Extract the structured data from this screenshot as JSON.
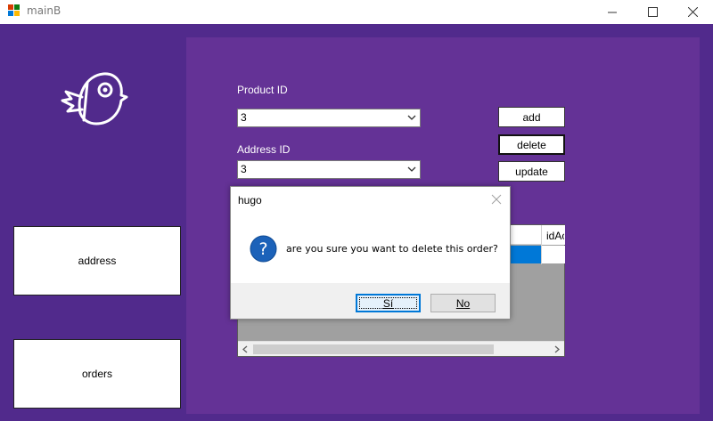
{
  "window": {
    "title": "mainB",
    "controls": [
      "minimize-icon",
      "maximize-icon",
      "close-icon"
    ]
  },
  "sidebar": {
    "logo_icon": "bird-icon",
    "address_label": "address",
    "orders_label": "orders"
  },
  "form": {
    "product_id_label": "Product ID",
    "product_id_value": "3",
    "address_id_label": "Address ID",
    "address_id_value": "3",
    "add_label": "add",
    "delete_label": "delete",
    "update_label": "update"
  },
  "grid": {
    "visible_column_header": "idAc"
  },
  "dialog": {
    "title": "hugo",
    "icon": "question-icon",
    "message": "are you sure you want to delete this order?",
    "yes_label": "Sí",
    "no_label": "No"
  },
  "colors": {
    "background": "#512a8c",
    "panel": "#643296",
    "selection": "#0078d7"
  }
}
